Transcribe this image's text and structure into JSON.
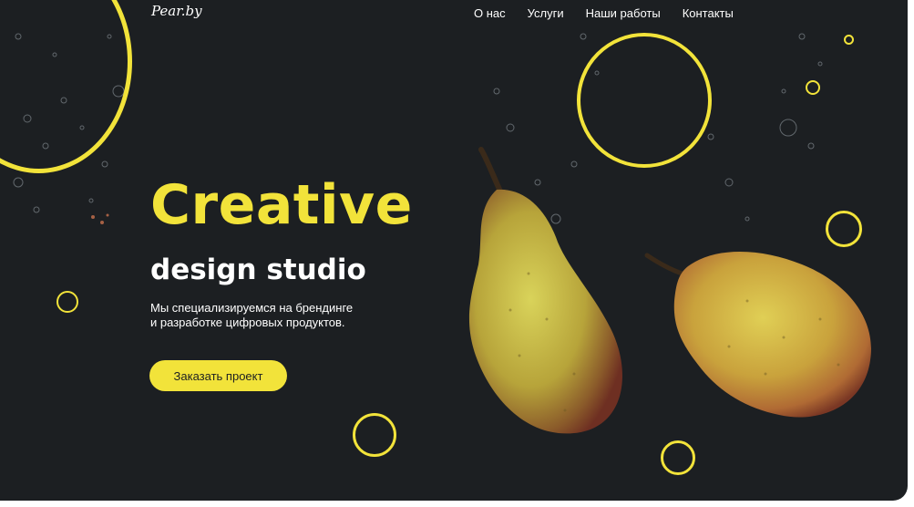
{
  "brand": {
    "logo_text": "Pear.by",
    "accent_color": "#f2e33a",
    "background_color": "#1c1f22"
  },
  "nav": {
    "items": [
      {
        "label": "О нас"
      },
      {
        "label": "Услуги"
      },
      {
        "label": "Наши работы"
      },
      {
        "label": "Контакты"
      }
    ]
  },
  "hero": {
    "title": "Creative",
    "subtitle": "design studio",
    "description_line1": "Мы специализируемся на брендинге",
    "description_line2": "и разработке цифровых продуктов.",
    "cta_label": "Заказать проект"
  },
  "imagery": {
    "main_icon": "pears-in-water-image",
    "decoration_icon": "yellow-ring-icon"
  }
}
